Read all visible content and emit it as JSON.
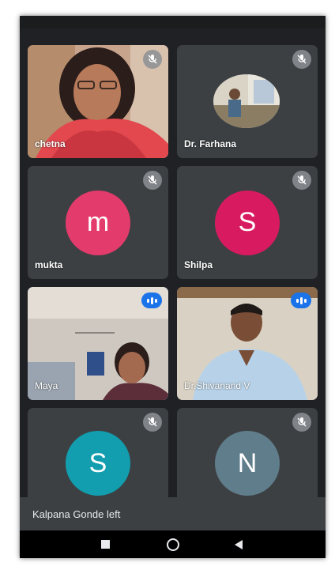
{
  "participants": [
    {
      "name": "chetna",
      "muted": true,
      "video": true
    },
    {
      "name": "Dr. Farhana",
      "muted": true,
      "video": true
    },
    {
      "name": "mukta",
      "muted": true,
      "video": false,
      "initial": "m",
      "avatar_color": "#e33b6b"
    },
    {
      "name": "Shilpa",
      "muted": true,
      "video": false,
      "initial": "S",
      "avatar_color": "#d81b60"
    },
    {
      "name": "Maya",
      "speaking": true,
      "video": true
    },
    {
      "name": "Dr.Shivanand V",
      "speaking": true,
      "video": true
    },
    {
      "name": "",
      "muted": true,
      "video": false,
      "initial": "S",
      "avatar_color": "#129eaf"
    },
    {
      "name": "",
      "muted": true,
      "video": false,
      "initial": "N",
      "avatar_color": "#607d8b"
    }
  ],
  "notification": {
    "text": "Kalpana Gonde left"
  },
  "navigation": {
    "recents_icon": "square-icon",
    "home_icon": "circle-icon",
    "back_icon": "back-triangle-icon"
  },
  "colors": {
    "background": "#202124",
    "tile": "#3c4043",
    "speaking_accent": "#1a73e8"
  }
}
